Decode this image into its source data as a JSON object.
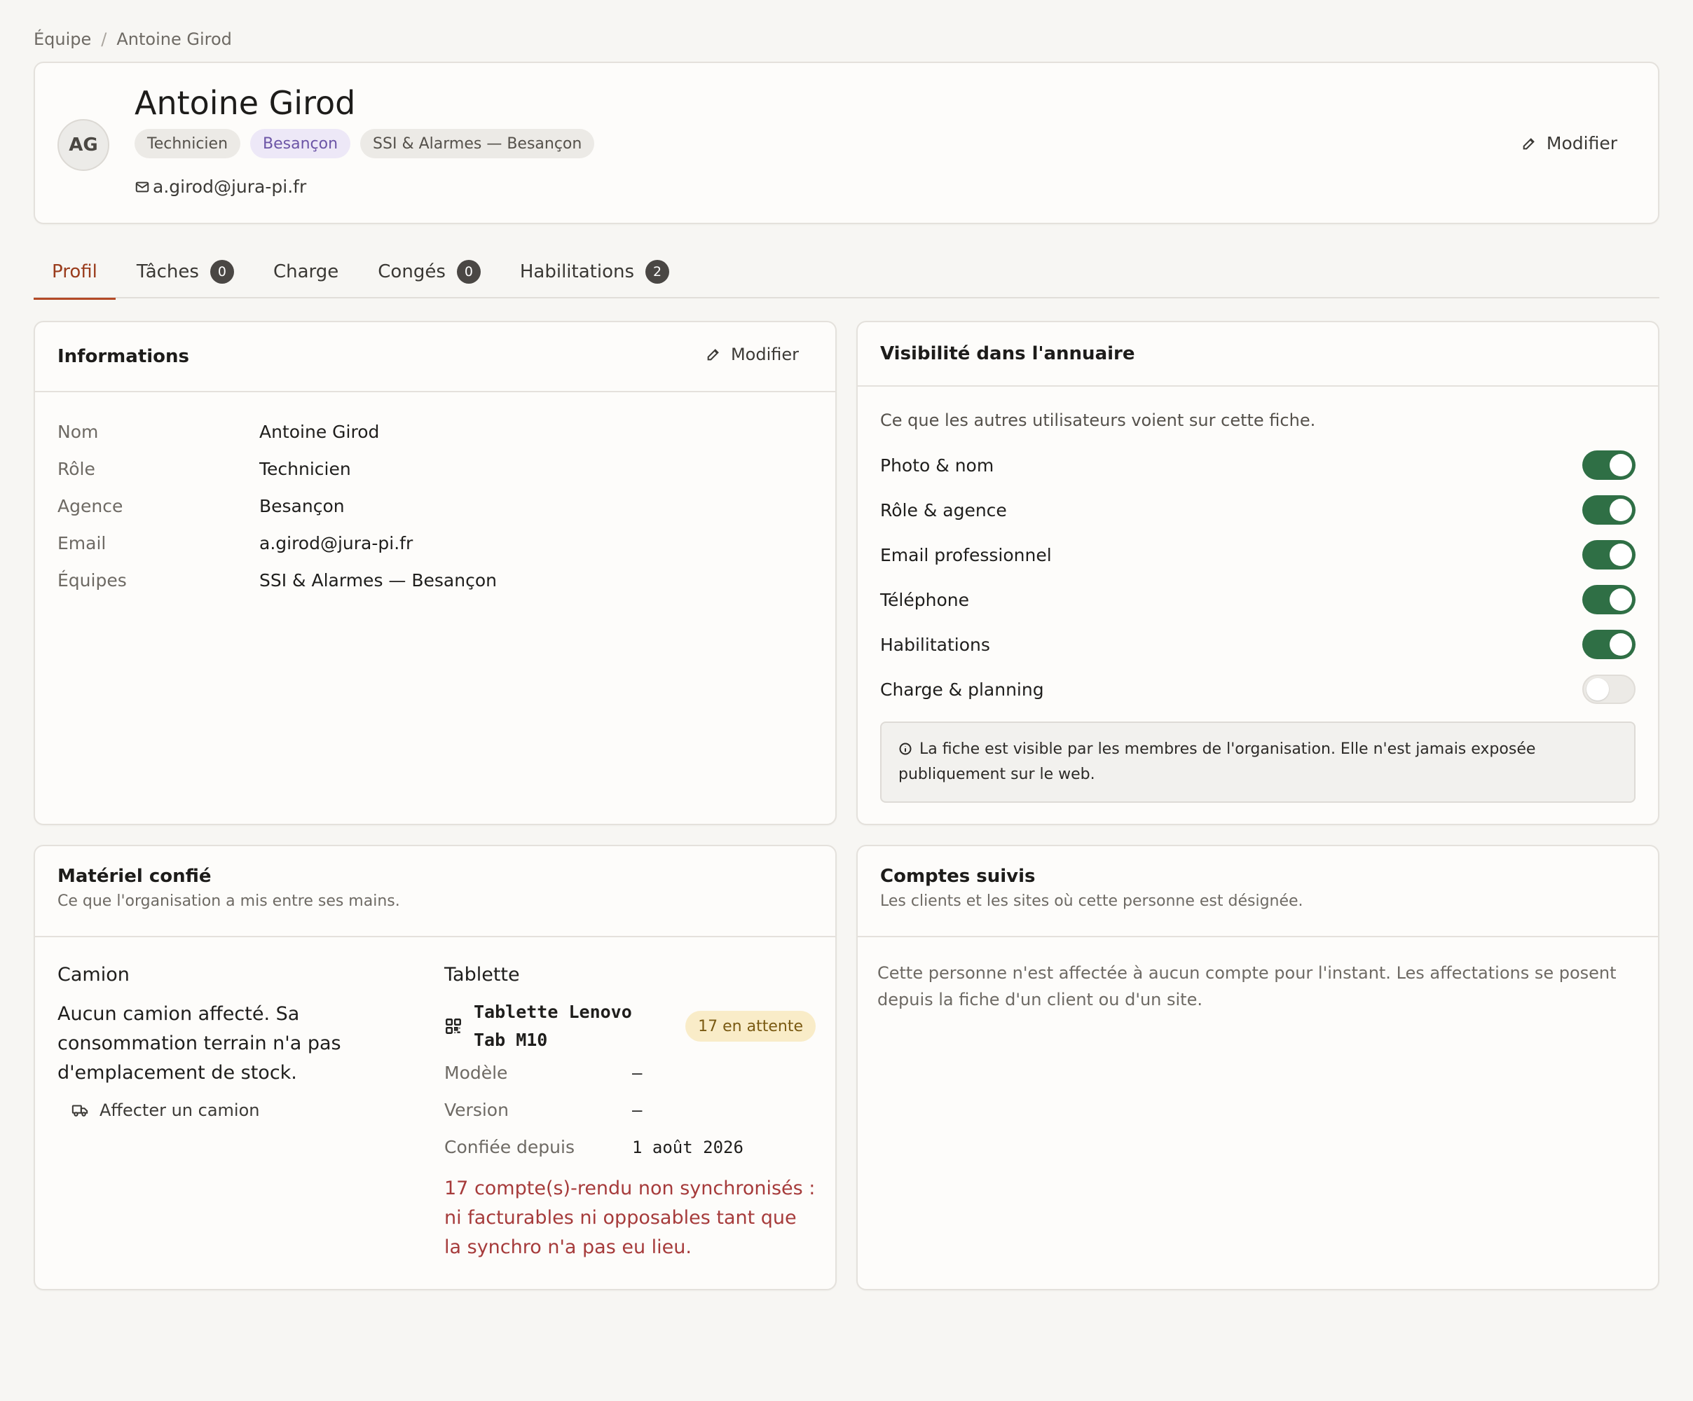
{
  "breadcrumb": {
    "parent": "Équipe",
    "separator": "/",
    "current": "Antoine Girod"
  },
  "header": {
    "initials": "AG",
    "name": "Antoine Girod",
    "chips": [
      "Technicien",
      "Besançon",
      "SSI & Alarmes — Besançon"
    ],
    "email": "a.girod@jura-pi.fr",
    "edit_label": "Modifier"
  },
  "tabs": [
    {
      "label": "Profil",
      "count": null,
      "active": true
    },
    {
      "label": "Tâches",
      "count": "0"
    },
    {
      "label": "Charge",
      "count": null
    },
    {
      "label": "Congés",
      "count": "0"
    },
    {
      "label": "Habilitations",
      "count": "2"
    }
  ],
  "info": {
    "title": "Informations",
    "edit_label": "Modifier",
    "rows": [
      {
        "key": "Nom",
        "value": "Antoine Girod"
      },
      {
        "key": "Rôle",
        "value": "Technicien"
      },
      {
        "key": "Agence",
        "value": "Besançon"
      },
      {
        "key": "Email",
        "value": "a.girod@jura-pi.fr"
      },
      {
        "key": "Équipes",
        "value": "SSI & Alarmes — Besançon"
      }
    ]
  },
  "visibility": {
    "title": "Visibilité dans l'annuaire",
    "description": "Ce que les autres utilisateurs voient sur cette fiche.",
    "toggles": [
      {
        "label": "Photo & nom",
        "on": true
      },
      {
        "label": "Rôle & agence",
        "on": true
      },
      {
        "label": "Email professionnel",
        "on": true
      },
      {
        "label": "Téléphone",
        "on": true
      },
      {
        "label": "Habilitations",
        "on": true
      },
      {
        "label": "Charge & planning",
        "on": false
      }
    ],
    "notice": "La fiche est visible par les membres de l'organisation. Elle n'est jamais exposée publiquement sur le web."
  },
  "equipment": {
    "title": "Matériel confié",
    "subtitle": "Ce que l'organisation a mis entre ses mains.",
    "truck": {
      "title": "Camion",
      "text": "Aucun camion affecté. Sa consommation terrain n'a pas d'emplacement de stock.",
      "assign_label": "Affecter un camion"
    },
    "tablet": {
      "title": "Tablette",
      "name": "Tablette Lenovo Tab M10",
      "pending": "17 en attente",
      "rows": [
        {
          "key": "Modèle",
          "value": "—"
        },
        {
          "key": "Version",
          "value": "—"
        },
        {
          "key": "Confiée depuis",
          "value": "1 août 2026"
        }
      ],
      "warning": "17 compte(s)-rendu non synchronisés : ni facturables ni opposables tant que la synchro n'a pas eu lieu."
    }
  },
  "accounts": {
    "title": "Comptes suivis",
    "subtitle": "Les clients et les sites où cette personne est désignée.",
    "empty": "Cette personne n'est affectée à aucun compte pour l'instant. Les affectations se posent depuis la fiche d'un client ou d'un site."
  },
  "colors": {
    "accent": "#b44a26",
    "toggle_on": "#2f6f45",
    "warning": "#a63b3b",
    "pending_bg": "#f9ecc8"
  }
}
